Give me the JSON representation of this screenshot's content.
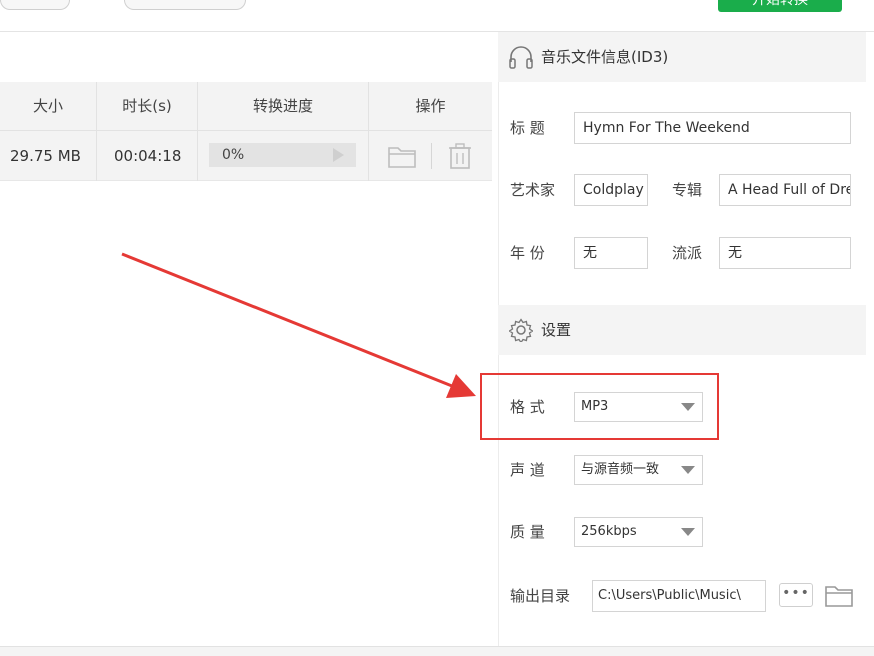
{
  "toolbar": {
    "start_button_label": "开始转换"
  },
  "table": {
    "headers": [
      "大小",
      "时长(s)",
      "转换进度",
      "操作"
    ],
    "rows": [
      {
        "size": "29.75 MB",
        "duration": "00:04:18",
        "progress": "0%",
        "progress_value": 0
      }
    ]
  },
  "id3": {
    "title": "音乐文件信息(ID3)",
    "title_label": "标 题",
    "title_value": "Hymn For The Weekend",
    "artist_label": "艺术家",
    "artist_value": "Coldplay",
    "album_label": "专辑",
    "album_value": "A Head Full of Dreams",
    "year_label": "年 份",
    "year_value": "无",
    "genre_label": "流派",
    "genre_value": "无"
  },
  "settings": {
    "title": "设置",
    "format_label": "格 式",
    "format_value": "MP3",
    "channel_label": "声 道",
    "channel_value": "与源音频一致",
    "quality_label": "质 量",
    "quality_value": "256kbps",
    "output_label": "输出目录",
    "output_value": "C:\\Users\\Public\\Music\\"
  },
  "colors": {
    "accent_green": "#1aad4b",
    "highlight_red": "#e53935"
  }
}
